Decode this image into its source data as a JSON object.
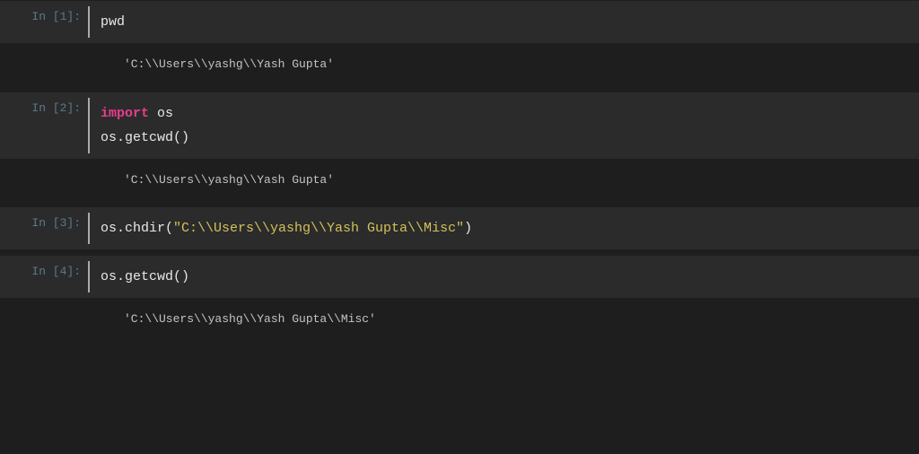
{
  "cells": [
    {
      "prompt": "In [1]:",
      "code": {
        "lines": [
          {
            "plain": "pwd"
          }
        ]
      },
      "output": "'C:\\\\Users\\\\yashg\\\\Yash Gupta'"
    },
    {
      "prompt": "In [2]:",
      "code": {
        "lines": [
          {
            "import_kw": "import",
            "module": " os"
          },
          {
            "plain": "os.getcwd()"
          }
        ]
      },
      "output": "'C:\\\\Users\\\\yashg\\\\Yash Gupta'"
    },
    {
      "prompt": "In [3]:",
      "code": {
        "lines": [
          {
            "call_prefix": "os.chdir(",
            "string": "\"C:\\\\Users\\\\yashg\\\\Yash Gupta\\\\Misc\"",
            "call_suffix": ")"
          }
        ]
      },
      "output": null
    },
    {
      "prompt": "In [4]:",
      "code": {
        "lines": [
          {
            "plain": "os.getcwd()"
          }
        ]
      },
      "output": "'C:\\\\Users\\\\yashg\\\\Yash Gupta\\\\Misc'"
    }
  ]
}
